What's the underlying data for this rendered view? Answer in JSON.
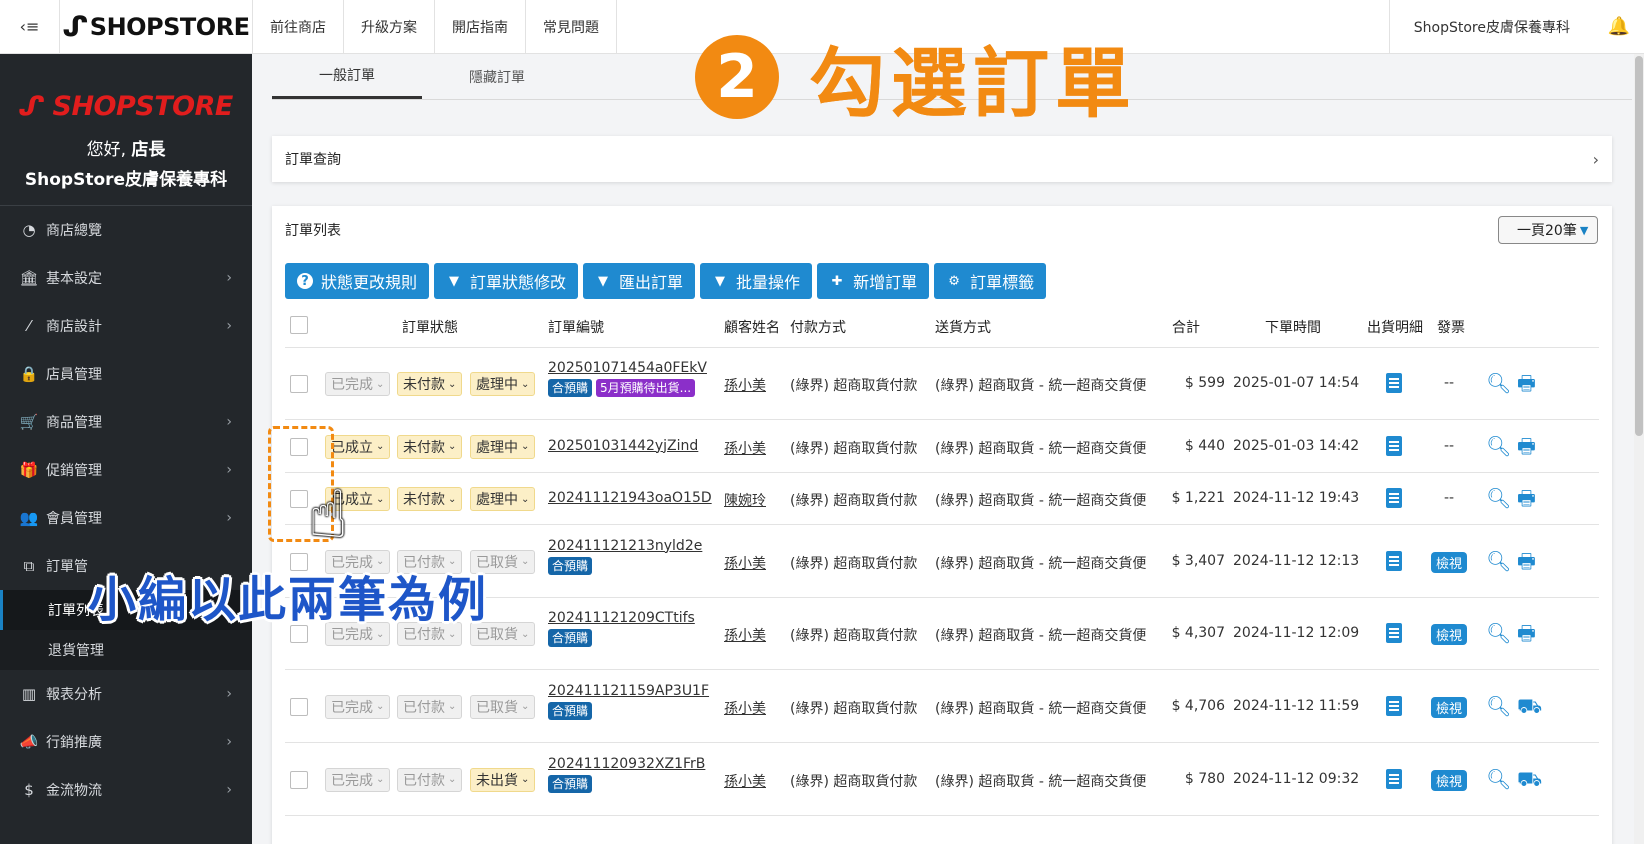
{
  "topbar": {
    "hamburger": "‹≡",
    "logo": "SHOPSTORE",
    "nav": [
      "前往商店",
      "升級方案",
      "開店指南",
      "常見問題"
    ],
    "store_name": "ShopStore皮膚保養專科"
  },
  "sidebar": {
    "logo": "SHOPSTORE",
    "greeting": "您好,",
    "role": "店長",
    "store": "ShopStore皮膚保養專科",
    "items": [
      {
        "label": "商店總覽",
        "icon": "dashboard-icon",
        "arrow": false
      },
      {
        "label": "基本設定",
        "icon": "bank-icon",
        "arrow": true
      },
      {
        "label": "商店設計",
        "icon": "magic-wand-icon",
        "arrow": true
      },
      {
        "label": "店員管理",
        "icon": "user-lock-icon",
        "arrow": false
      },
      {
        "label": "商品管理",
        "icon": "cart-icon",
        "arrow": true
      },
      {
        "label": "促銷管理",
        "icon": "gift-icon",
        "arrow": true
      },
      {
        "label": "會員管理",
        "icon": "users-icon",
        "arrow": true
      },
      {
        "label": "訂單管",
        "icon": "copy-icon",
        "arrow": false
      }
    ],
    "subitems": [
      "訂單列表",
      "退貨管理"
    ],
    "items_after": [
      {
        "label": "報表分析",
        "icon": "bar-chart-icon",
        "arrow": true
      },
      {
        "label": "行銷推廣",
        "icon": "megaphone-icon",
        "arrow": true
      },
      {
        "label": "金流物流",
        "icon": "dollar-icon",
        "arrow": true
      }
    ]
  },
  "tabs": [
    "一般訂單",
    "隱藏訂單"
  ],
  "query": {
    "title": "訂單查詢"
  },
  "list": {
    "title": "訂單列表",
    "per_page": "一頁20筆",
    "buttons": [
      "狀態更改規則",
      "訂單狀態修改",
      "匯出訂單",
      "批量操作",
      "新增訂單",
      "訂單標籤"
    ],
    "headers": [
      "訂單狀態",
      "訂單編號",
      "顧客姓名",
      "付款方式",
      "送貨方式",
      "合計",
      "下單時間",
      "出貨明細",
      "發票"
    ],
    "rows": [
      {
        "s1": "已完成",
        "s1c": "gray",
        "s2": "未付款",
        "s2c": "yellow",
        "s3": "處理中",
        "s3c": "yellow",
        "order": "202501071454a0FEkV",
        "badges": [
          "合預購",
          "5月預購待出貨..."
        ],
        "customer": "孫小美",
        "payment": "(綠界) 超商取貨付款",
        "shipping": "(綠界) 超商取貨 - 統一超商交貨便",
        "total": "$ 599",
        "time": "2025-01-07 14:54",
        "invoice": "--",
        "action": "print"
      },
      {
        "s1": "已成立",
        "s1c": "yellow",
        "s2": "未付款",
        "s2c": "yellow",
        "s3": "處理中",
        "s3c": "yellow",
        "order": "202501031442yjZind",
        "badges": [],
        "customer": "孫小美",
        "payment": "(綠界) 超商取貨付款",
        "shipping": "(綠界) 超商取貨 - 統一超商交貨便",
        "total": "$ 440",
        "time": "2025-01-03 14:42",
        "invoice": "--",
        "action": "print"
      },
      {
        "s1": "已成立",
        "s1c": "yellow",
        "s2": "未付款",
        "s2c": "yellow",
        "s3": "處理中",
        "s3c": "yellow",
        "order": "202411121943oaO15D",
        "badges": [],
        "customer": "陳婉玲",
        "payment": "(綠界) 超商取貨付款",
        "shipping": "(綠界) 超商取貨 - 統一超商交貨便",
        "total": "$ 1,221",
        "time": "2024-11-12 19:43",
        "invoice": "--",
        "action": "print"
      },
      {
        "s1": "已完成",
        "s1c": "gray",
        "s2": "已付款",
        "s2c": "gray",
        "s3": "已取貨",
        "s3c": "gray",
        "order": "202411121213nyld2e",
        "badges": [
          "合預購"
        ],
        "customer": "孫小美",
        "payment": "(綠界) 超商取貨付款",
        "shipping": "(綠界) 超商取貨 - 統一超商交貨便",
        "total": "$ 3,407",
        "time": "2024-11-12 12:13",
        "invoice": "檢視",
        "action": "print"
      },
      {
        "s1": "已完成",
        "s1c": "gray",
        "s2": "已付款",
        "s2c": "gray",
        "s3": "已取貨",
        "s3c": "gray",
        "order": "202411121209CTtifs",
        "badges": [
          "合預購"
        ],
        "customer": "孫小美",
        "payment": "(綠界) 超商取貨付款",
        "shipping": "(綠界) 超商取貨 - 統一超商交貨便",
        "total": "$ 4,307",
        "time": "2024-11-12 12:09",
        "invoice": "檢視",
        "action": "print"
      },
      {
        "s1": "已完成",
        "s1c": "gray",
        "s2": "已付款",
        "s2c": "gray",
        "s3": "已取貨",
        "s3c": "gray",
        "order": "202411121159AP3U1F",
        "badges": [
          "合預購"
        ],
        "customer": "孫小美",
        "payment": "(綠界) 超商取貨付款",
        "shipping": "(綠界) 超商取貨 - 統一超商交貨便",
        "total": "$ 4,706",
        "time": "2024-11-12 11:59",
        "invoice": "檢視",
        "action": "truck"
      },
      {
        "s1": "已完成",
        "s1c": "gray",
        "s2": "已付款",
        "s2c": "gray",
        "s3": "未出貨",
        "s3c": "yellow",
        "order": "202411120932XZ1FrB",
        "badges": [
          "合預購"
        ],
        "customer": "孫小美",
        "payment": "(綠界) 超商取貨付款",
        "shipping": "(綠界) 超商取貨 - 統一超商交貨便",
        "total": "$ 780",
        "time": "2024-11-12 09:32",
        "invoice": "檢視",
        "action": "truck"
      }
    ]
  },
  "overlay": {
    "step_number": "2",
    "step_title": "勾選訂單",
    "caption": "小編以此兩筆為例"
  },
  "colors": {
    "accent": "#1f8ad0",
    "sidebar": "#23272b",
    "highlight": "#f28a12",
    "caption": "#1e56c8"
  }
}
